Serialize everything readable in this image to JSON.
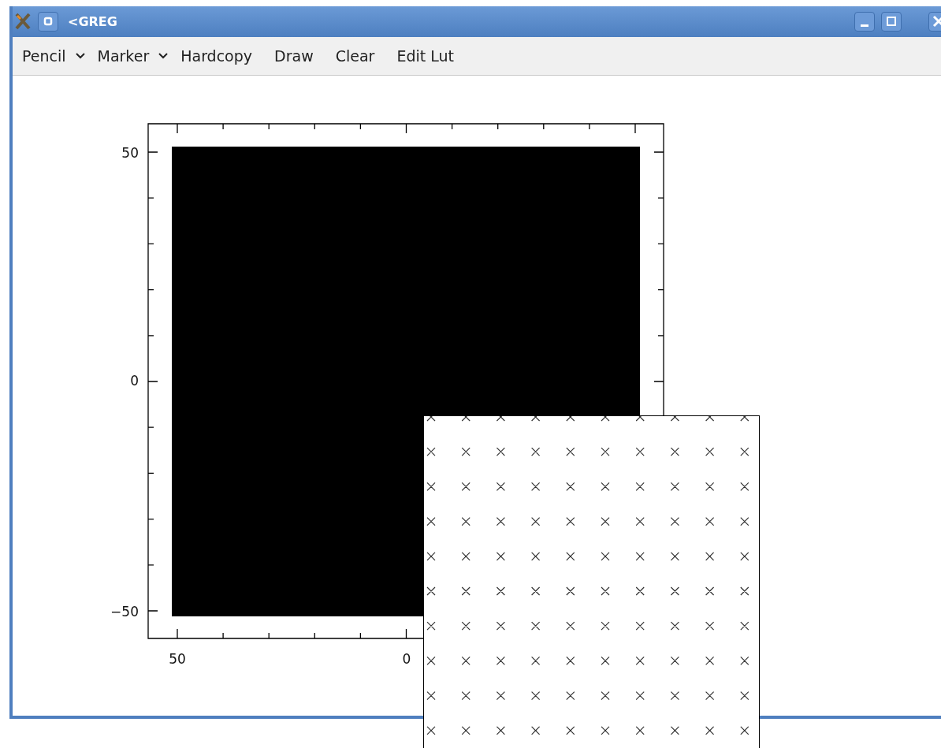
{
  "window": {
    "title": "<GREG"
  },
  "menu": [
    {
      "label": "Pencil",
      "kind": "dropdown"
    },
    {
      "label": "Marker",
      "kind": "dropdown"
    },
    {
      "label": "Hardcopy",
      "kind": "button"
    },
    {
      "label": "Draw",
      "kind": "button"
    },
    {
      "label": "Clear",
      "kind": "button"
    },
    {
      "label": "Edit Lut",
      "kind": "button"
    }
  ],
  "plot": {
    "y_ticks": [
      "50",
      "0",
      "−50"
    ],
    "x_ticks": [
      "50",
      "0"
    ]
  },
  "overlay": {
    "kind": "marker-grid"
  }
}
